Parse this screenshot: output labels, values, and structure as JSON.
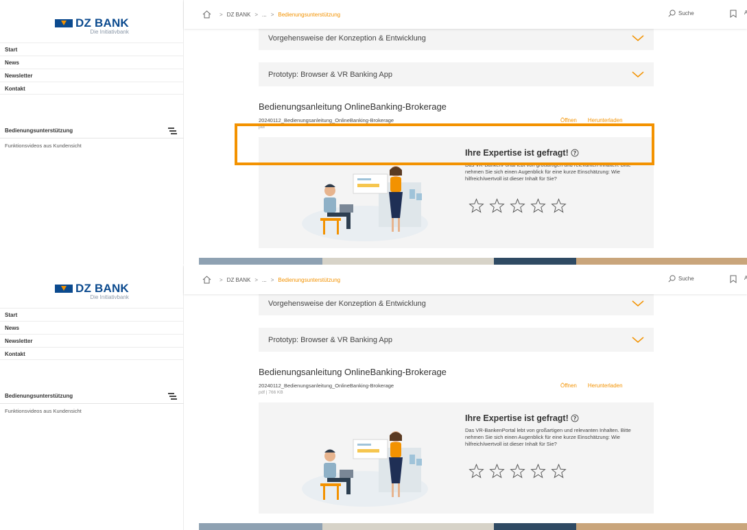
{
  "logo": {
    "name": "DZ BANK",
    "tagline": "Die Initiativbank"
  },
  "nav": {
    "items": [
      {
        "label": "Start"
      },
      {
        "label": "News"
      },
      {
        "label": "Newsletter"
      },
      {
        "label": "Kontakt"
      }
    ]
  },
  "section": {
    "title": "Bedienungsunterstützung",
    "sub": "Funktionsvideos aus Kundensicht"
  },
  "breadcrumb": {
    "items": [
      "DZ BANK",
      "...",
      "Bedienungsunterstützung"
    ]
  },
  "header": {
    "search_label": "Suche",
    "more_letter": "A"
  },
  "accordion": {
    "items": [
      {
        "label": "Vorgehensweise der Konzeption & Entwicklung"
      },
      {
        "label": "Prototyp: Browser & VR Banking App"
      }
    ]
  },
  "document": {
    "title": "Bedienungsanleitung OnlineBanking-Brokerage",
    "filename": "20240112_Bedienungsanleitung_OnlineBanking-Brokerage",
    "meta_top": "pdf",
    "meta_bottom": "pdf | 766 KB",
    "open_label": "Öffnen",
    "download_label": "Herunterladen"
  },
  "rating": {
    "title": "Ihre Expertise ist gefragt!",
    "text_top": "Das VR-BankenPortal lebt von großartigen und relevanten Inhalten. Bitte nehmen Sie sich einen Augenblick für eine kurze Einschätzung: Wie hilfreich/wertvoll ist dieser Inhalt für Sie?",
    "text_bottom": "Das VR-BankenPortal lebt von großartigen und relevanten Inhalten. Bitte nehmen Sie sich einen Augenblick für eine kurze Einschätzung: Wie hilfreich/wertvoll ist dieser Inhalt für Sie?",
    "stars_count": 5
  },
  "colors": {
    "accent": "#f39200",
    "brand": "#0b4a8e",
    "panel": "#f4f4f4"
  },
  "icons": [
    "home-icon",
    "search-icon",
    "bookmark-icon",
    "chevron-down-icon",
    "help-icon",
    "star-icon",
    "toc-icon"
  ]
}
